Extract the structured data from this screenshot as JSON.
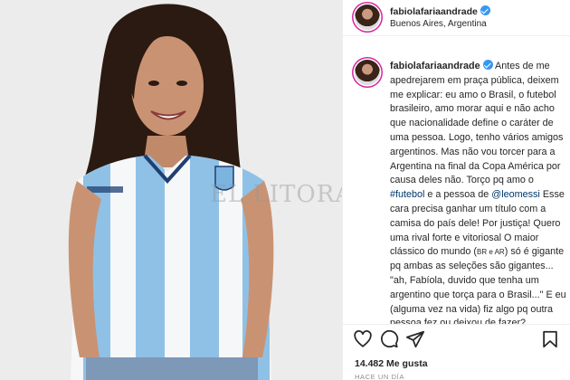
{
  "post": {
    "photo_watermark": "EL LITORAL",
    "header": {
      "username": "fabiolafariaandrade",
      "location": "Buenos Aires, Argentina"
    },
    "caption": {
      "username": "fabiolafariaandrade",
      "text_1": "Antes de me apedrejarem em praça pública, deixem me explicar: eu amo o Brasil, o futebol brasileiro, amo morar aqui e não acho que nacionalidade define o caráter de uma pessoa. Logo, tenho vários amigos argentinos. Mas não vou torcer para a Argentina na final da Copa América por causa deles não. Torço pq amo o ",
      "hashtag": "#futebol",
      "text_2": " e a pessoa de ",
      "mention": "@leomessi",
      "text_3": " Esse cara precisa ganhar um título com a camisa do país dele! Por justiça! Quero uma rival forte e vitoriosal O maior clássico do mundo (",
      "small_caps": "BR e AR",
      "text_4": ") só é gigante pq ambas as seleções são gigantes... \"ah, Fabíola, duvido que tenha um argentino que torça para o Brasil...\" E eu (alguma vez na vida) fiz algo pq outra pessoa fez ou deixou de fazer?"
    },
    "likes": "14.482 Me gusta",
    "timestamp": "HACE UN DÍA",
    "icons": [
      "heart-icon",
      "comment-icon",
      "share-icon",
      "bookmark-icon"
    ],
    "colors": {
      "verified": "#3897f0",
      "link": "#00376b",
      "jersey_blue": "#8fc1e6",
      "text": "#262626"
    }
  }
}
